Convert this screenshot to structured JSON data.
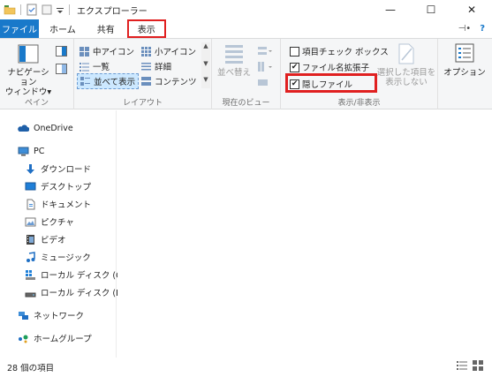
{
  "window": {
    "title": "エクスプローラー",
    "minimize": "—",
    "maximize": "☐",
    "close": "✕"
  },
  "tabs": [
    {
      "label": "ファイル"
    },
    {
      "label": "ホーム"
    },
    {
      "label": "共有"
    },
    {
      "label": "表示"
    }
  ],
  "tabs_right": {
    "pin": "⊣•",
    "help": "?"
  },
  "ribbon": {
    "pane": {
      "nav_button_line1": "ナビゲーション",
      "nav_button_line2": "ウィンドウ▾",
      "label": "ペイン"
    },
    "layout": {
      "items": [
        "中アイコン",
        "小アイコン",
        "一覧",
        "詳細",
        "並べて表示",
        "コンテンツ"
      ],
      "label": "レイアウト"
    },
    "current_view": {
      "sort_line1": "並べ替え",
      "label": "現在のビュー"
    },
    "show_hide": {
      "item_checkbox": "項目チェック ボックス",
      "file_ext": "ファイル名拡張子",
      "hidden_files": "隠しファイル",
      "hide_selected_line1": "選択した項目を",
      "hide_selected_line2": "表示しない",
      "label": "表示/非表示"
    },
    "options": {
      "label": "オプション"
    }
  },
  "nav": {
    "items": [
      "OneDrive",
      "PC",
      "ダウンロード",
      "デスクトップ",
      "ドキュメント",
      "ピクチャ",
      "ビデオ",
      "ミュージック",
      "ローカル ディスク (C:)",
      "ローカル ディスク (E:)",
      "ネットワーク",
      "ホームグループ"
    ]
  },
  "status": {
    "count": "28 個の項目"
  },
  "colors": {
    "accent": "#1979ca",
    "highlight": "#e02020"
  }
}
